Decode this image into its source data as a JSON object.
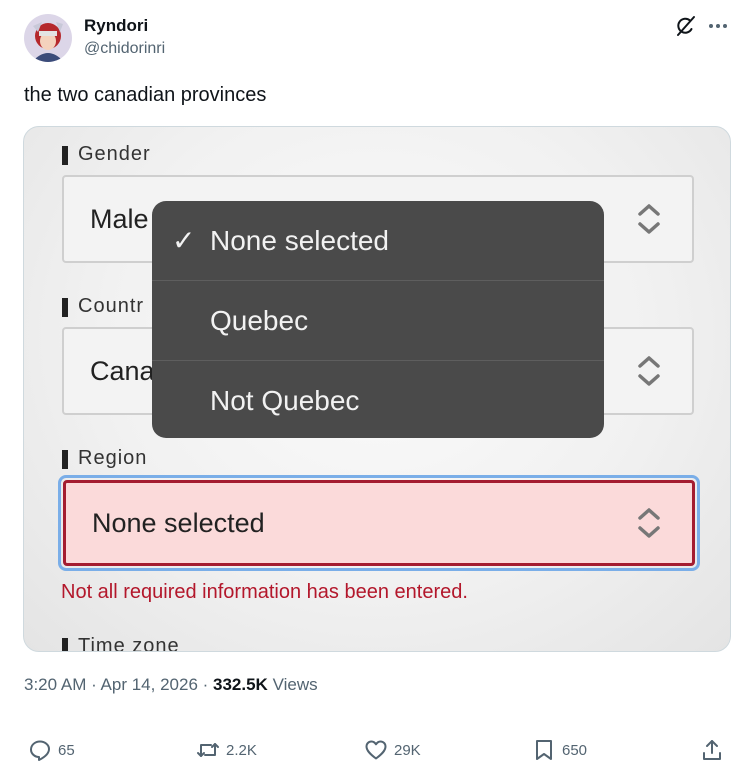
{
  "author": {
    "display_name": "Ryndori",
    "handle": "@chidorinri"
  },
  "tweet": {
    "text": "the two canadian provinces"
  },
  "form": {
    "gender": {
      "label": "Gender",
      "value": "Male"
    },
    "country": {
      "label": "Countr",
      "value": "Cana"
    },
    "region": {
      "label": "Region",
      "value": "None selected"
    },
    "timezone": {
      "label": "Time zone"
    },
    "error": "Not all required information has been entered."
  },
  "dropdown": {
    "options": [
      {
        "label": "None selected",
        "selected": true,
        "check": "✓"
      },
      {
        "label": "Quebec",
        "selected": false
      },
      {
        "label": "Not Quebec",
        "selected": false
      }
    ]
  },
  "meta": {
    "time": "3:20 AM",
    "sep1": " · ",
    "date": "Apr 14, 2026",
    "sep2": " · ",
    "views_count": "332.5K",
    "views_label": " Views"
  },
  "actions": {
    "replies": "65",
    "reposts": "2.2K",
    "likes": "29K",
    "bookmarks": "650"
  },
  "colors": {
    "error_red": "#b3172b",
    "region_fill": "#fbdada",
    "focus_ring": "#7aaee8",
    "dropdown_bg": "#4a4a4a"
  }
}
